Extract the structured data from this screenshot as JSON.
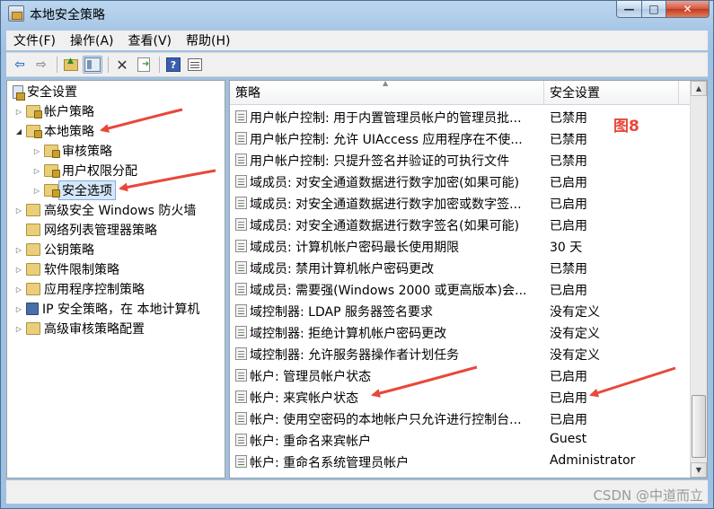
{
  "window": {
    "title": "本地安全策略",
    "controls": {
      "minimize": "—",
      "maximize": "□",
      "close": "✕"
    }
  },
  "menu": [
    "文件(F)",
    "操作(A)",
    "查看(V)",
    "帮助(H)"
  ],
  "toolbar": {
    "icons": [
      "back-arrow-icon",
      "forward-arrow-icon",
      "up-folder-icon",
      "show-hide-tree-icon",
      "delete-icon",
      "export-list-icon",
      "help-icon",
      "properties-icon"
    ]
  },
  "tree": {
    "root": "安全设置",
    "items": [
      {
        "label": "帐户策略",
        "level": 1,
        "expanded": false,
        "icon": "locked-folder-icon"
      },
      {
        "label": "本地策略",
        "level": 1,
        "expanded": true,
        "icon": "locked-folder-icon"
      },
      {
        "label": "审核策略",
        "level": 2,
        "expanded": false,
        "icon": "locked-folder-icon"
      },
      {
        "label": "用户权限分配",
        "level": 2,
        "expanded": false,
        "icon": "locked-folder-icon"
      },
      {
        "label": "安全选项",
        "level": 2,
        "expanded": false,
        "icon": "locked-folder-icon",
        "selected": true
      },
      {
        "label": "高级安全 Windows 防火墙",
        "level": 1,
        "expanded": false,
        "icon": "folder-icon"
      },
      {
        "label": "网络列表管理器策略",
        "level": 1,
        "expanded": false,
        "icon": "folder-icon",
        "no_expander": true
      },
      {
        "label": "公钥策略",
        "level": 1,
        "expanded": false,
        "icon": "folder-icon"
      },
      {
        "label": "软件限制策略",
        "level": 1,
        "expanded": false,
        "icon": "folder-icon"
      },
      {
        "label": "应用程序控制策略",
        "level": 1,
        "expanded": false,
        "icon": "folder-icon"
      },
      {
        "label": "IP 安全策略，在 本地计算机",
        "level": 1,
        "expanded": false,
        "icon": "ipsec-icon"
      },
      {
        "label": "高级审核策略配置",
        "level": 1,
        "expanded": false,
        "icon": "folder-icon"
      }
    ]
  },
  "list": {
    "columns": [
      "策略",
      "安全设置"
    ],
    "rows": [
      {
        "policy": "用户帐户控制: 用于内置管理员帐户的管理员批...",
        "setting": "已禁用"
      },
      {
        "policy": "用户帐户控制: 允许 UIAccess 应用程序在不使...",
        "setting": "已禁用"
      },
      {
        "policy": "用户帐户控制: 只提升签名并验证的可执行文件",
        "setting": "已禁用"
      },
      {
        "policy": "域成员: 对安全通道数据进行数字加密(如果可能)",
        "setting": "已启用"
      },
      {
        "policy": "域成员: 对安全通道数据进行数字加密或数字签...",
        "setting": "已启用"
      },
      {
        "policy": "域成员: 对安全通道数据进行数字签名(如果可能)",
        "setting": "已启用"
      },
      {
        "policy": "域成员: 计算机帐户密码最长使用期限",
        "setting": "30 天"
      },
      {
        "policy": "域成员: 禁用计算机帐户密码更改",
        "setting": "已禁用"
      },
      {
        "policy": "域成员: 需要强(Windows 2000 或更高版本)会...",
        "setting": "已启用"
      },
      {
        "policy": "域控制器: LDAP 服务器签名要求",
        "setting": "没有定义"
      },
      {
        "policy": "域控制器: 拒绝计算机帐户密码更改",
        "setting": "没有定义"
      },
      {
        "policy": "域控制器: 允许服务器操作者计划任务",
        "setting": "没有定义"
      },
      {
        "policy": "帐户: 管理员帐户状态",
        "setting": "已启用"
      },
      {
        "policy": "帐户: 来宾帐户状态",
        "setting": "已启用"
      },
      {
        "policy": "帐户: 使用空密码的本地帐户只允许进行控制台...",
        "setting": "已启用"
      },
      {
        "policy": "帐户: 重命名来宾帐户",
        "setting": "Guest"
      },
      {
        "policy": "帐户: 重命名系统管理员帐户",
        "setting": "Administrator"
      }
    ]
  },
  "annotations": {
    "figure_label": "图8",
    "watermark": "CSDN @中道而立",
    "arrow_color": "#e8483a"
  }
}
